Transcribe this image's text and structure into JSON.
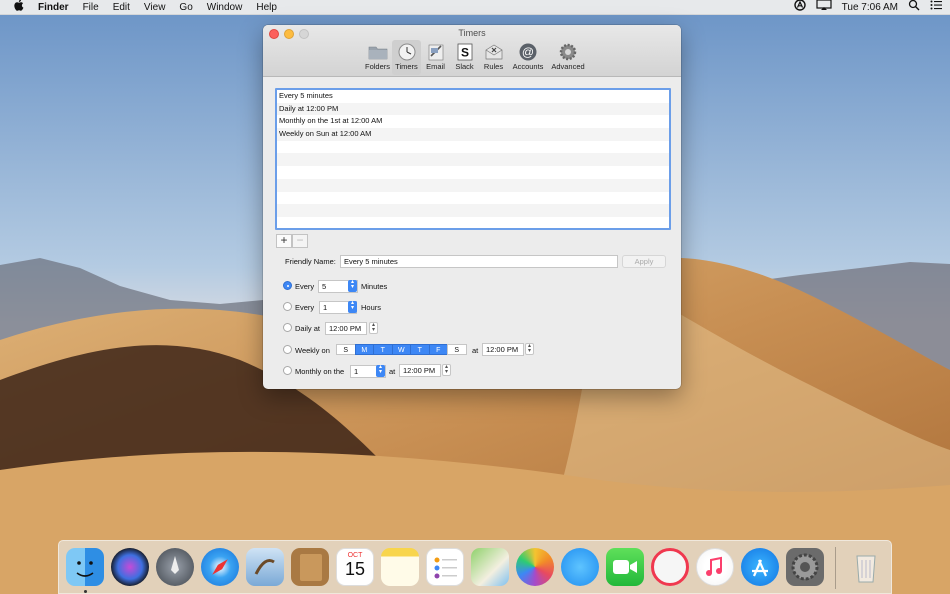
{
  "menubar": {
    "app_name": "Finder",
    "items": [
      "File",
      "Edit",
      "View",
      "Go",
      "Window",
      "Help"
    ],
    "clock": "Tue 7:06 AM"
  },
  "window": {
    "title": "Timers",
    "toolbar": [
      {
        "label": "Folders",
        "icon": "folder-icon",
        "selected": false
      },
      {
        "label": "Timers",
        "icon": "clock-icon",
        "selected": true
      },
      {
        "label": "Email",
        "icon": "email-icon",
        "selected": false
      },
      {
        "label": "Slack",
        "icon": "slack-icon",
        "selected": false
      },
      {
        "label": "Rules",
        "icon": "rules-icon",
        "selected": false
      },
      {
        "label": "Accounts",
        "icon": "at-sign-icon",
        "selected": false
      },
      {
        "label": "Advanced",
        "icon": "gear-icon",
        "selected": false
      }
    ],
    "timers": [
      "Every 5 minutes",
      "Daily at 12:00 PM",
      "Monthly on the 1st at 12:00 AM",
      "Weekly on Sun at 12:00 AM"
    ],
    "add_label": "+",
    "remove_label": "−",
    "friendly_name_label": "Friendly Name:",
    "friendly_name_value": "Every 5 minutes",
    "apply_label": "Apply",
    "options": {
      "every_minutes": {
        "label": "Every",
        "value": "5",
        "unit": "Minutes",
        "selected": true
      },
      "every_hours": {
        "label": "Every",
        "value": "1",
        "unit": "Hours",
        "selected": false
      },
      "daily": {
        "label": "Daily at",
        "time": "12:00 PM",
        "selected": false
      },
      "weekly": {
        "label": "Weekly on",
        "days": [
          {
            "label": "S",
            "selected": false
          },
          {
            "label": "M",
            "selected": true
          },
          {
            "label": "T",
            "selected": true
          },
          {
            "label": "W",
            "selected": true
          },
          {
            "label": "T",
            "selected": true
          },
          {
            "label": "F",
            "selected": true
          },
          {
            "label": "S",
            "selected": false
          }
        ],
        "at_label": "at",
        "time": "12:00 PM",
        "selected": false
      },
      "monthly": {
        "label": "Monthly on the",
        "value": "1",
        "at_label": "at",
        "time": "12:00 PM",
        "selected": false
      }
    }
  },
  "dock": {
    "apps": [
      "finder-icon",
      "siri-icon",
      "launchpad-icon",
      "safari-icon",
      "mail-icon",
      "contacts-icon",
      "calendar-icon",
      "notes-icon",
      "reminders-icon",
      "maps-icon",
      "photos-icon",
      "messages-icon",
      "facetime-icon",
      "news-icon",
      "music-icon",
      "app-store-icon",
      "system-preferences-icon",
      "trash-icon"
    ],
    "calendar_month": "OCT",
    "calendar_day": "15"
  }
}
